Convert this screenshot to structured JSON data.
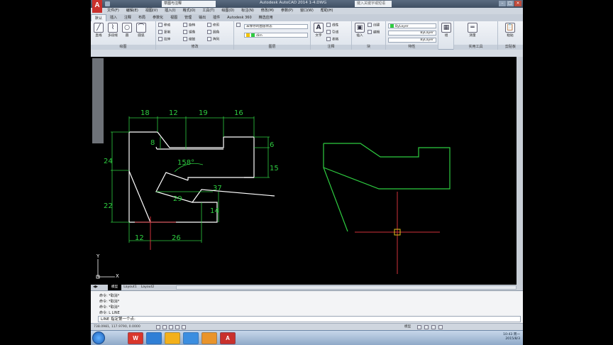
{
  "window": {
    "title": "Autodesk AutoCAD 2014   1-4.DWG",
    "workspace": "草图与注释",
    "search_placeholder": "键入关键字或短语"
  },
  "menu": [
    "文件(F)",
    "编辑(E)",
    "视图(V)",
    "插入(I)",
    "格式(O)",
    "工具(T)",
    "绘图(D)",
    "标注(N)",
    "修改(M)",
    "参数(P)",
    "窗口(W)",
    "帮助(H)"
  ],
  "ribbon_tabs": [
    "默认",
    "插入",
    "注释",
    "布局",
    "参数化",
    "视图",
    "管理",
    "输出",
    "插件",
    "Autodesk 360",
    "精选应用"
  ],
  "ribbon": {
    "draw": {
      "title": "绘图",
      "line": "直线",
      "polyline": "多段线",
      "circle": "圆",
      "arc": "圆弧"
    },
    "modify": {
      "title": "修改",
      "move": "移动",
      "rotate": "旋转",
      "trim": "修剪",
      "copy": "复制",
      "mirror": "镜像",
      "fillet": "圆角",
      "stretch": "拉伸",
      "scale": "缩放",
      "array": "阵列"
    },
    "layer": {
      "title": "图层",
      "state": "未保存的图层状态",
      "current": "dim",
      "color": "#2ecc40"
    },
    "annotation": {
      "title": "注释",
      "text": "文字",
      "linear": "线性",
      "leader": "引线",
      "table": "表格"
    },
    "block": {
      "title": "块",
      "insert": "插入",
      "create": "创建",
      "edit": "编辑"
    },
    "properties": {
      "title": "特性",
      "color": "ByLayer",
      "linetype": "ByLayer",
      "lineweight": "ByLayer"
    },
    "groups": {
      "group": "组"
    },
    "utilities": {
      "title": "实用工具",
      "measure": "测量",
      "paste": "粘贴",
      "clipboard": "剪贴板"
    }
  },
  "drawing": {
    "line_color": "#2ecc40",
    "dim_color": "#2ecc40",
    "crosshair_color": "#d0323a",
    "object_lines": "#ffffff",
    "dims": {
      "d18": "18",
      "d12a": "12",
      "d19": "19",
      "d16": "16",
      "d8": "8",
      "d6": "6",
      "d24": "24",
      "d15": "15",
      "d158": "158°",
      "d37": "37",
      "d29": "29",
      "d22": "22",
      "d14": "14",
      "d12b": "12",
      "d26": "26"
    },
    "ucs": {
      "x": "X",
      "y": "Y"
    }
  },
  "layout_tabs": [
    "模型",
    "Layout1",
    "Layout2"
  ],
  "command": {
    "history": [
      "命令: *取消*",
      "命令: *取消*",
      "命令: *取消*",
      "命令: L LINE"
    ],
    "prompt": "LINE 指定第一个点:"
  },
  "status": {
    "coords": "738.0981, 117.9790, 0.0000",
    "model": "模型"
  },
  "taskbar": {
    "apps": [
      "W",
      "",
      "",
      "",
      "",
      "A"
    ],
    "time": "10:43 周一",
    "date": "2015/8/3"
  }
}
